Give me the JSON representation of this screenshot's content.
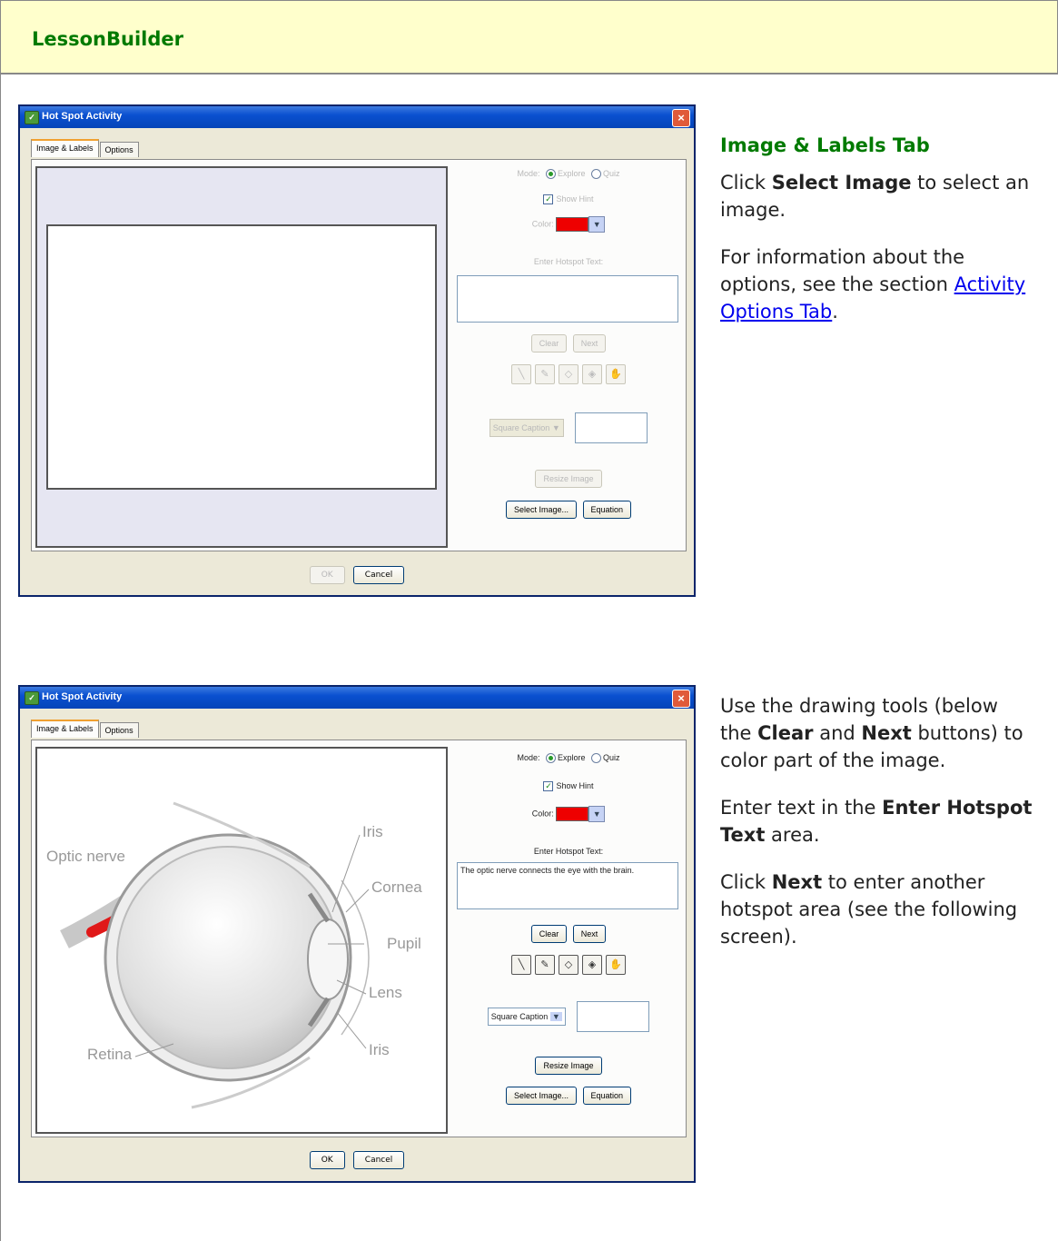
{
  "header": {
    "title": "LessonBuilder"
  },
  "section": {
    "title": "Image & Labels Tab"
  },
  "desc1": {
    "p1_pre": "Click ",
    "p1_bold": "Select Image",
    "p1_post": " to select an image.",
    "p2_pre": "For information about the options, see the section ",
    "p2_link": "Activity Options Tab",
    "p2_post": "."
  },
  "desc2": {
    "p1_a": "Use the drawing tools (below the ",
    "p1_b": "Clear",
    "p1_c": " and ",
    "p1_d": "Next",
    "p1_e": " buttons) to color part of the image.",
    "p2_a": "Enter text in the ",
    "p2_b": "Enter Hotspot Text",
    "p2_c": " area.",
    "p3_a": "Click ",
    "p3_b": "Next",
    "p3_c": " to enter another hotspot area (see the following screen)."
  },
  "dialog": {
    "title": "Hot Spot Activity",
    "tabs": [
      "Image & Labels",
      "Options"
    ],
    "mode_label": "Mode:",
    "explore": "Explore",
    "quiz": "Quiz",
    "show_hint": "Show Hint",
    "color_label": "Color:",
    "enter_text_label": "Enter Hotspot Text:",
    "clear": "Clear",
    "next": "Next",
    "caption": "Square Caption",
    "resize": "Resize Image",
    "select_image": "Select Image...",
    "equation": "Equation",
    "ok": "OK",
    "cancel": "Cancel",
    "color_hex": "#ee0000"
  },
  "dialog2": {
    "hotspot_text": "The optic nerve connects the eye with the brain.",
    "eye_labels": {
      "iris_top": "Iris",
      "optic": "Optic nerve",
      "cornea": "Cornea",
      "pupil": "Pupil",
      "lens": "Lens",
      "retina": "Retina",
      "iris_bottom": "Iris"
    }
  }
}
